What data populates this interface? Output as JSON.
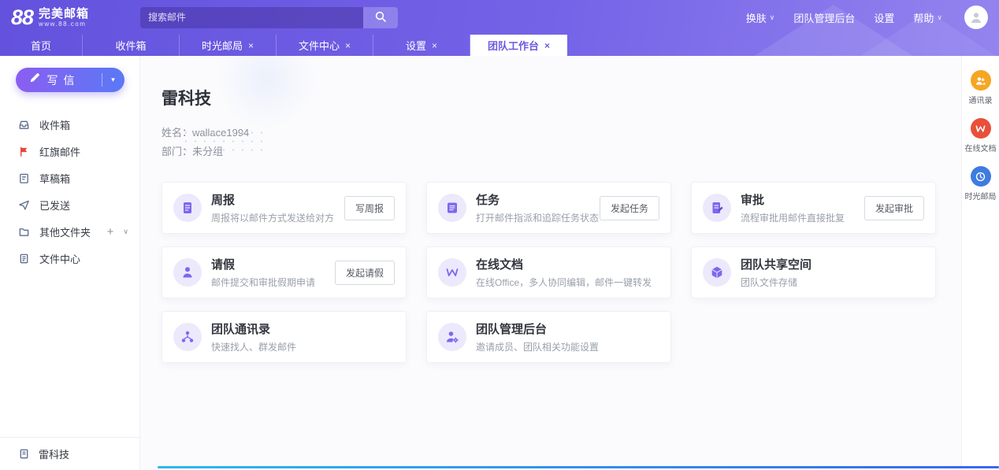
{
  "ui": {
    "close_glyph": "×",
    "chevron_glyph": "∨",
    "plus_glyph": "+",
    "caret_glyph": "▾"
  },
  "colors": {
    "header_purple": "#6a5ae0",
    "accent": "#7b68ee",
    "rail_contacts": "#f5a623",
    "rail_docs": "#e8503a",
    "rail_timemail": "#3f7be0"
  },
  "header": {
    "logo_mark": "88",
    "logo_name": "完美邮箱",
    "logo_domain": "www.88.com",
    "search_placeholder": "搜索邮件",
    "nav": [
      {
        "label": "换肤"
      },
      {
        "label": "团队管理后台"
      },
      {
        "label": "设置"
      },
      {
        "label": "帮助"
      }
    ]
  },
  "tabs": [
    {
      "label": "首页"
    },
    {
      "label": "收件箱"
    },
    {
      "label": "时光邮局",
      "closable": true
    },
    {
      "label": "文件中心",
      "closable": true
    },
    {
      "label": "设置",
      "closable": true
    },
    {
      "label": "团队工作台",
      "closable": true,
      "active": true
    }
  ],
  "sidebar": {
    "compose_label": "写信",
    "items": [
      {
        "label": "收件箱",
        "icon": "inbox-icon"
      },
      {
        "label": "红旗邮件",
        "icon": "flag-icon"
      },
      {
        "label": "草稿箱",
        "icon": "draft-icon"
      },
      {
        "label": "已发送",
        "icon": "sent-icon"
      },
      {
        "label": "其他文件夹",
        "icon": "folder-icon",
        "has_add": true
      },
      {
        "label": "文件中心",
        "icon": "file-center-icon"
      }
    ],
    "team_name": "雷科技"
  },
  "main": {
    "title": "雷科技",
    "profile": {
      "name_label": "姓名：",
      "name_value": "wallace1994",
      "dept_label": "部门：",
      "dept_value": "未分组"
    },
    "cards": [
      {
        "title": "周报",
        "desc": "周报将以邮件方式发送给对方",
        "button": "写周报",
        "icon": "weekly-report-icon"
      },
      {
        "title": "任务",
        "desc": "打开邮件指派和追踪任务状态",
        "button": "发起任务",
        "icon": "task-icon"
      },
      {
        "title": "审批",
        "desc": "流程审批用邮件直接批复",
        "button": "发起审批",
        "icon": "approval-icon"
      },
      {
        "title": "请假",
        "desc": "邮件提交和审批假期申请",
        "button": "发起请假",
        "icon": "leave-icon"
      },
      {
        "title": "在线文档",
        "desc": "在线Office，多人协同编辑，邮件一键转发",
        "icon": "online-doc-icon"
      },
      {
        "title": "团队共享空间",
        "desc": "团队文件存储",
        "icon": "shared-space-icon"
      },
      {
        "title": "团队通讯录",
        "desc": "快速找人、群发邮件",
        "icon": "team-contacts-icon"
      },
      {
        "title": "团队管理后台",
        "desc": "邀请成员、团队相关功能设置",
        "icon": "team-admin-icon"
      }
    ]
  },
  "right_rail": {
    "items": [
      {
        "label": "通讯录",
        "icon": "contacts-icon"
      },
      {
        "label": "在线文档",
        "icon": "online-doc-icon"
      },
      {
        "label": "时光邮局",
        "icon": "time-mail-icon"
      }
    ]
  }
}
